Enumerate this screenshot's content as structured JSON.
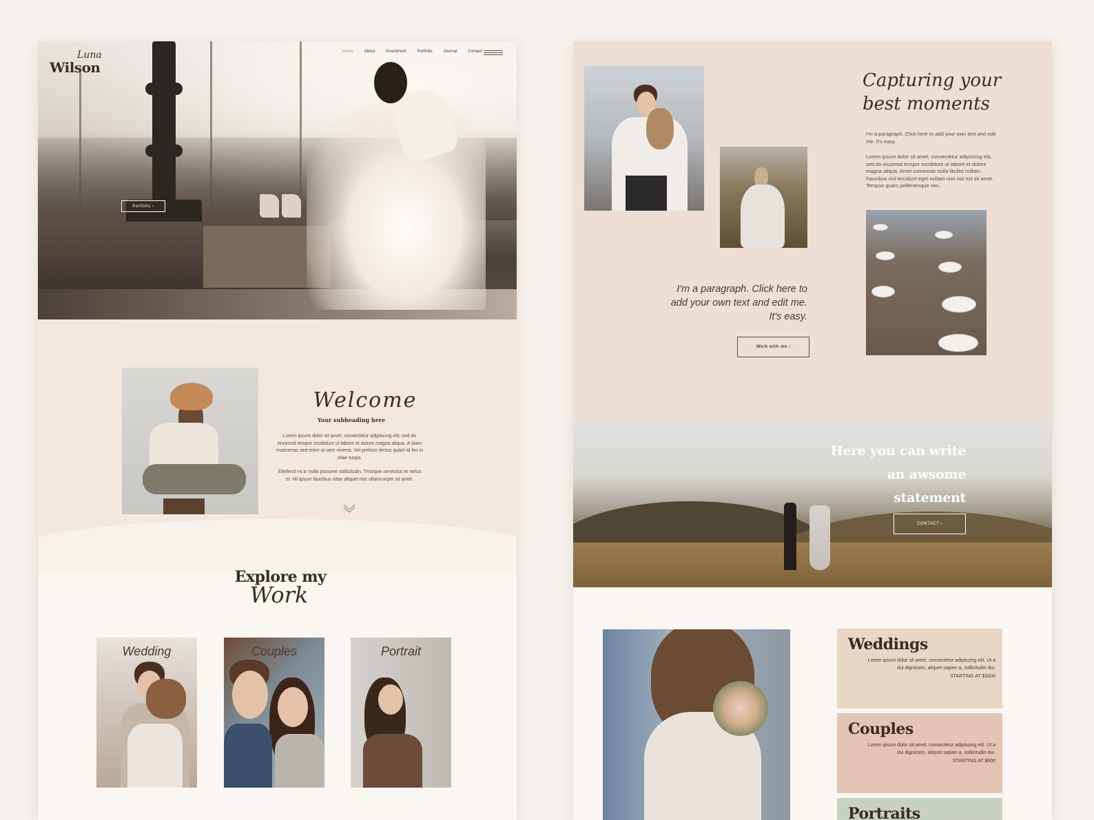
{
  "left_page": {
    "logo": {
      "script": "Luna",
      "name": "Wilson"
    },
    "nav": {
      "items": [
        {
          "label": "Home",
          "active": true
        },
        {
          "label": "About",
          "active": false
        },
        {
          "label": "Investment",
          "active": false
        },
        {
          "label": "Portfolio",
          "active": false
        },
        {
          "label": "Journal",
          "active": false
        },
        {
          "label": "Contact",
          "active": false
        }
      ],
      "menu_icon": "hamburger-menu-icon"
    },
    "hero": {
      "button_label": "Portfolio ›"
    },
    "welcome": {
      "title": "Welcome",
      "subheading": "Your subheading here",
      "paragraph1": "Lorem ipsum dolor sit amet, consectetur adipiscing elit, sed do eiusmod tempor incididunt ut labore et dolore magna aliqua. A diam maecenas sed enim ut sem viverra. Vel pretium lectus quam id leo in vitae turpis.",
      "paragraph2": "Eleifend mi in nulla posuere sollicitudin. Tristique senectus et netus et. Mi ipsum faucibus vitae aliquet nec ullamcorper sit amet.",
      "scroll_icon": "double-chevron-down-icon"
    },
    "explore": {
      "title": "Explore my",
      "script": "Work",
      "cards": [
        {
          "label": "Wedding"
        },
        {
          "label": "Couples"
        },
        {
          "label": "Portrait"
        }
      ]
    }
  },
  "right_page": {
    "capturing": {
      "title_line1": "Capturing your",
      "title_line2": "best moments",
      "paragraph1": "I'm a paragraph. Click here to add your own text and edit me. It's easy.",
      "paragraph2": "Lorem ipsum dolor sit amet, consectetur adipiscing elit, sed do eiusmod tempor incididunt ut labore et dolore magna aliqua. Amet commodo nulla facilisi nullam. Faucibus nisl tincidunt eget nullam non nisi est sit amet. Tempus quam pellentesque nec.",
      "quote": "I'm a paragraph. Click here to add your own text and edit me. It's easy.",
      "button_label": "Work with me ›"
    },
    "statement": {
      "line1": "Here you can write",
      "line2": "an awsome",
      "line3": "statement",
      "button_label": "CONTACT ›"
    },
    "services": [
      {
        "title": "Weddings",
        "description": "Lorem ipsum dolor sit amet, consectetur adipiscing elit. Ut a dui dignissim, aliquet sapien a, sollicitudin dui.",
        "price": "STARTING AT $3000"
      },
      {
        "title": "Couples",
        "description": "Lorem ipsum dolor sit amet, consectetur adipiscing elit. Ut a dui dignissim, aliquet sapien a, sollicitudin dui.",
        "price": "STARTING AT $600"
      },
      {
        "title": "Portraits"
      }
    ]
  },
  "colors": {
    "background": "#f6f1ec",
    "accent_nav": "#c08a63",
    "text_dark": "#3b2b20",
    "welcome_bg": "#f3e8df",
    "capturing_bg": "#eddfd3",
    "wedding_card": "#e9d6c4",
    "couples_card": "#e4c4b4",
    "portraits_card": "#c9d0c4"
  }
}
